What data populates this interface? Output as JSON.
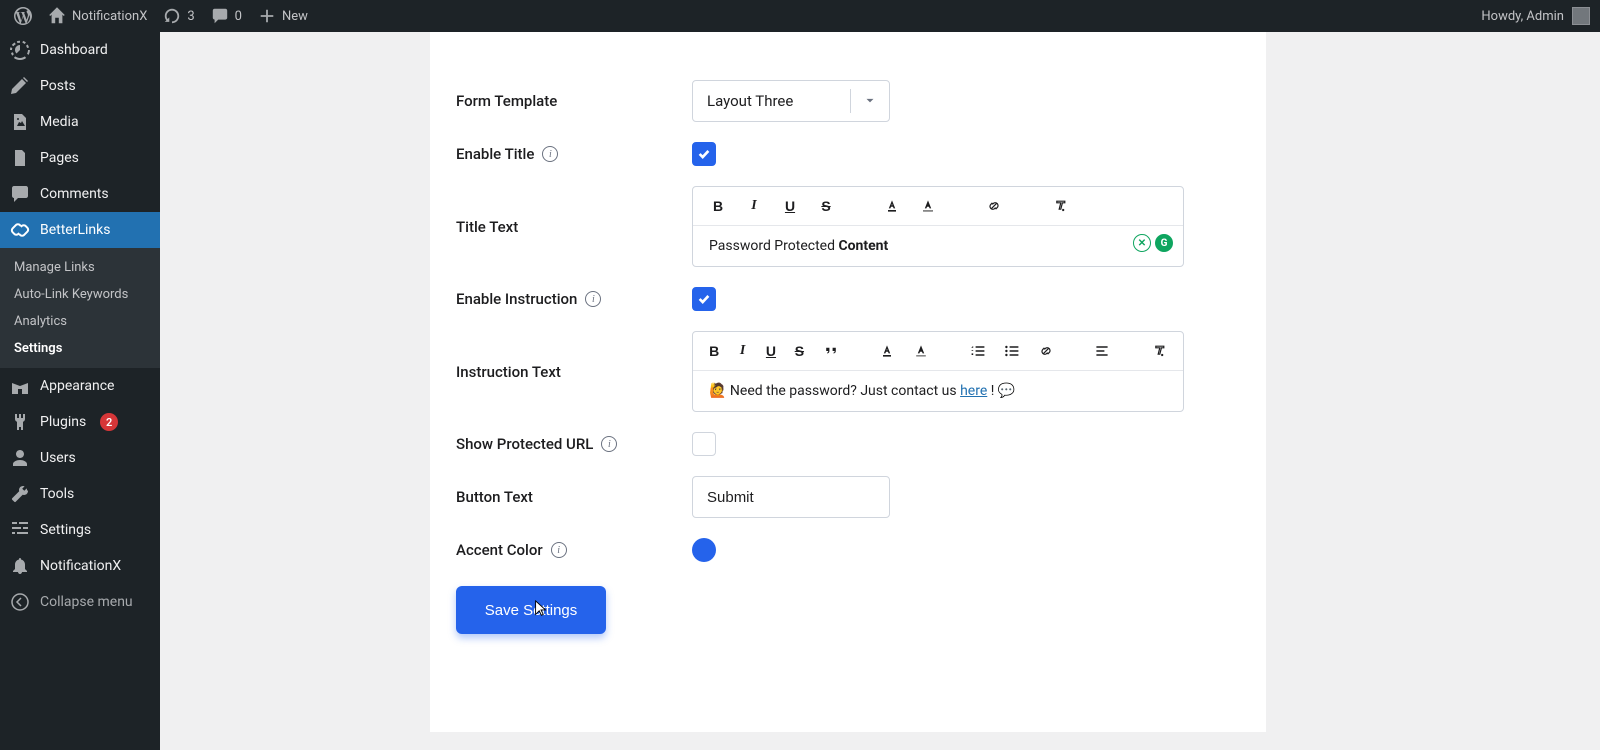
{
  "adminbar": {
    "site": "NotificationX",
    "updates": "3",
    "comments": "0",
    "new": "New",
    "howdy": "Howdy, Admin"
  },
  "sidebar": {
    "dashboard": "Dashboard",
    "posts": "Posts",
    "media": "Media",
    "pages": "Pages",
    "comments": "Comments",
    "betterlinks": "BetterLinks",
    "submenu": {
      "manage": "Manage Links",
      "autolink": "Auto-Link Keywords",
      "analytics": "Analytics",
      "settings": "Settings"
    },
    "appearance": "Appearance",
    "plugins": "Plugins",
    "plugins_badge": "2",
    "users": "Users",
    "tools": "Tools",
    "settings": "Settings",
    "notificationx": "NotificationX",
    "collapse": "Collapse menu"
  },
  "form": {
    "template_label": "Form Template",
    "template_value": "Layout Three",
    "enable_title_label": "Enable Title",
    "enable_title_checked": true,
    "title_text_label": "Title Text",
    "title_text_prefix": "Password Protected ",
    "title_text_bold": "Content",
    "enable_instruction_label": "Enable Instruction",
    "enable_instruction_checked": true,
    "instruction_text_label": "Instruction Text",
    "instruction_prefix": "🙋 Need the password? Just contact us ",
    "instruction_link": "here",
    "instruction_suffix": " ! 💬",
    "show_protected_url_label": "Show Protected URL",
    "show_protected_url_checked": false,
    "button_text_label": "Button Text",
    "button_text_value": "Submit",
    "accent_color_label": "Accent Color",
    "accent_color_value": "#2563eb",
    "save": "Save Settings"
  }
}
